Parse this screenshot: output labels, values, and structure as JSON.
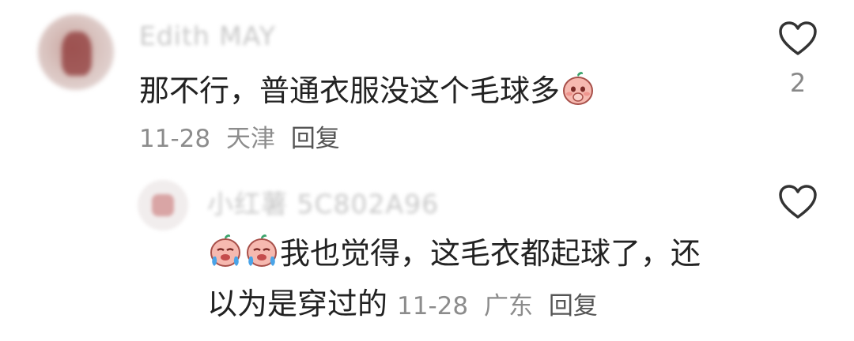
{
  "comments": [
    {
      "username": "Edith MAY",
      "text": "那不行，普通衣服没这个毛球多",
      "emoji": "shy-peach-emoji",
      "date": "11-28",
      "location": "天津",
      "reply_label": "回复",
      "likes": "2"
    }
  ],
  "reply": {
    "username": "小红薯 5C802A96",
    "emojis": [
      "crying-peach-emoji",
      "crying-peach-emoji"
    ],
    "text_line1": "我也觉得，这毛衣都起球了，还",
    "text_line2": "以为是穿过的",
    "date": "11-28",
    "location": "广东",
    "reply_label": "回复"
  },
  "colors": {
    "text": "#222222",
    "meta": "#8c8c8c",
    "icon": "#333333"
  },
  "icons": {
    "like": "heart-outline-icon"
  }
}
